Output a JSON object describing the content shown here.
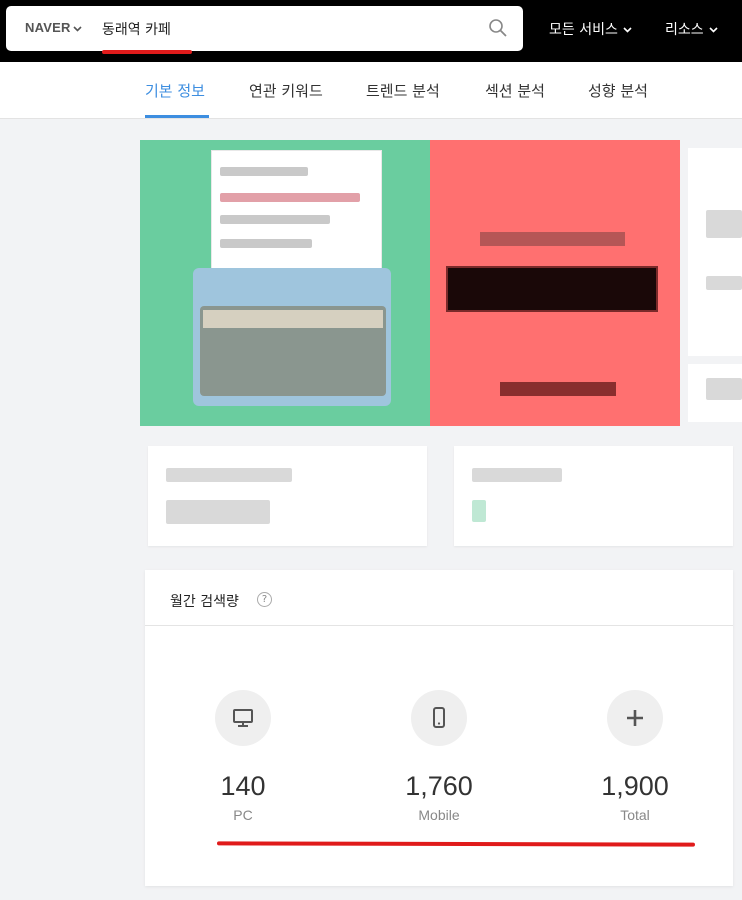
{
  "header": {
    "brand": "NAVER",
    "search_query": "동래역 카페",
    "menu_all_services": "모든 서비스",
    "menu_resources": "리소스"
  },
  "tabs": [
    {
      "label": "기본 정보",
      "active": true
    },
    {
      "label": "연관 키워드",
      "active": false
    },
    {
      "label": "트렌드 분석",
      "active": false
    },
    {
      "label": "섹션 분석",
      "active": false
    },
    {
      "label": "성향 분석",
      "active": false
    }
  ],
  "monthly_volume": {
    "title": "월간 검색량",
    "help_symbol": "?",
    "metrics": [
      {
        "value": "140",
        "label": "PC",
        "icon": "monitor-icon"
      },
      {
        "value": "1,760",
        "label": "Mobile",
        "icon": "smartphone-icon"
      },
      {
        "value": "1,900",
        "label": "Total",
        "icon": "plus-icon"
      }
    ]
  },
  "colors": {
    "accent": "#3d8ee0",
    "highlight_underline": "#e01b1b",
    "hero_green": "#6acd9f",
    "hero_red": "#ff7070"
  }
}
